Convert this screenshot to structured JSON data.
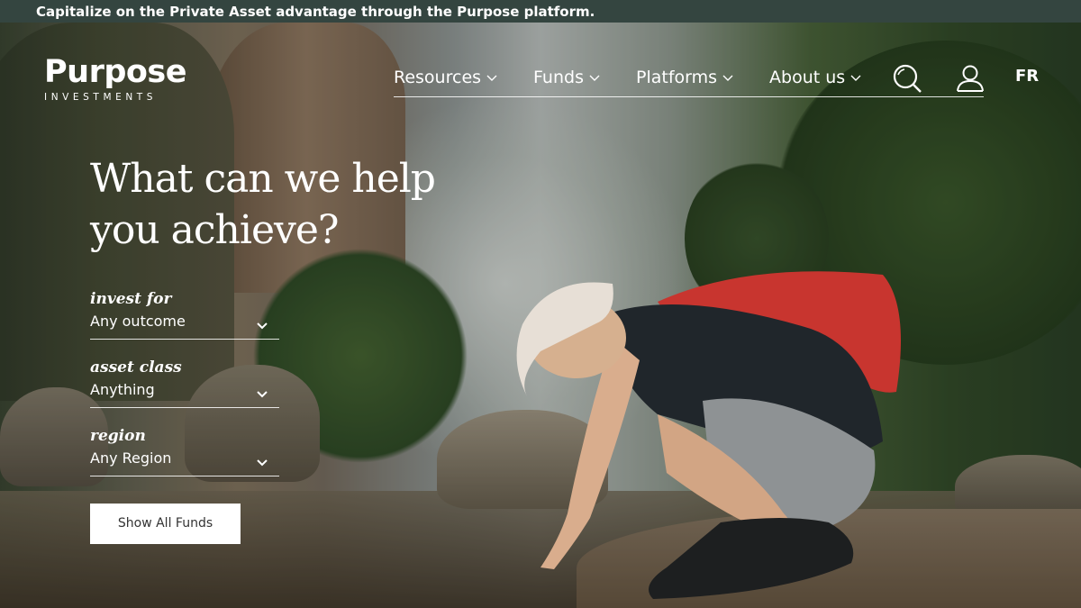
{
  "banner": {
    "text": "Capitalize on the Private Asset advantage through the Purpose platform."
  },
  "logo": {
    "name": "Purpose",
    "sub": "INVESTMENTS"
  },
  "nav": {
    "items": [
      {
        "label": "Resources"
      },
      {
        "label": "Funds"
      },
      {
        "label": "Platforms"
      },
      {
        "label": "About us"
      }
    ],
    "lang": "FR",
    "search_icon": "search-icon",
    "user_icon": "user-icon"
  },
  "hero": {
    "headline": "What can we help you achieve?",
    "filters": [
      {
        "label": "invest for",
        "value": "Any outcome"
      },
      {
        "label": "asset class",
        "value": "Anything"
      },
      {
        "label": "region",
        "value": "Any Region"
      }
    ],
    "button": "Show All Funds"
  },
  "colors": {
    "banner_bg": "#344540",
    "text": "#ffffff"
  }
}
